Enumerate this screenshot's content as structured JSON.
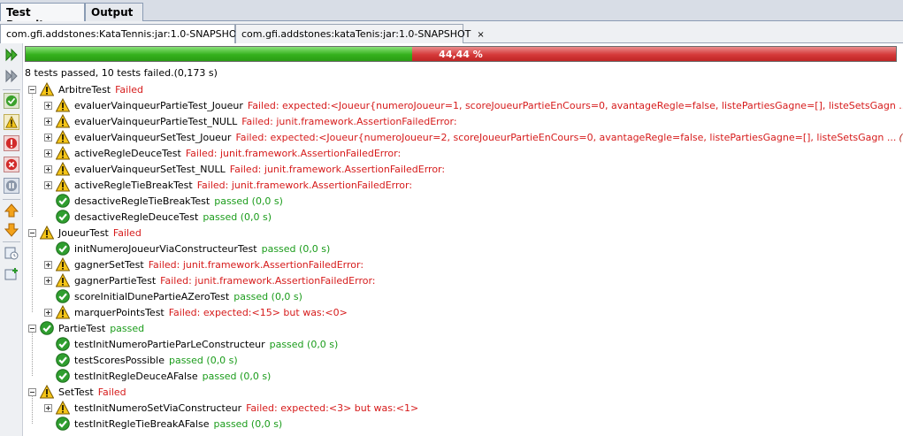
{
  "tabs": [
    {
      "label": "Test Results",
      "close": "×"
    },
    {
      "label": "Output"
    }
  ],
  "project_tabs": [
    {
      "label": "com.gfi.addstones:KataTennis:jar:1.0-SNAPSHOT",
      "close": "×"
    },
    {
      "label": "com.gfi.addstones:kataTenis:jar:1.0-SNAPSHOT",
      "close": "×"
    }
  ],
  "toolbar_icons": [
    "rerun-icon",
    "rerun-failed-icon",
    "show-passed-icon",
    "show-failures-icon",
    "show-errors-icon",
    "show-aborted-icon",
    "show-skipped-icon",
    "previous-failure-icon",
    "next-failure-icon",
    "history-icon",
    "new-test-icon"
  ],
  "progress": {
    "percent_label": "44,44 %",
    "passed_fraction": 0.4444
  },
  "summary": "8 tests passed, 10 tests failed.(0,173 s)",
  "colors": {
    "passed": "#1b9c1b",
    "failed": "#d61b1b",
    "progress_green": "#35b11d",
    "progress_red": "#d53a3a"
  },
  "suites": [
    {
      "name": "ArbitreTest",
      "status": "Failed",
      "result": "failed",
      "tests": [
        {
          "name": "evaluerVainqueurPartieTest_Joueur",
          "message": "Failed: expected:<Joueur{numeroJoueur=1, scoreJoueurPartieEnCours=0, avantageRegle=false, listePartiesGagne=[], listeSetsGagn ...",
          "omitted": "(132 chars omitted)",
          "result": "failed"
        },
        {
          "name": "evaluerVainqueurPartieTest_NULL",
          "message": "Failed: junit.framework.AssertionFailedError:",
          "result": "failed"
        },
        {
          "name": "evaluerVainqueurSetTest_Joueur",
          "message": "Failed: expected:<Joueur{numeroJoueur=2, scoreJoueurPartieEnCours=0, avantageRegle=false, listePartiesGagne=[], listeSetsGagn ...",
          "omitted": "(132 chars omitted)",
          "result": "failed"
        },
        {
          "name": "activeRegleDeuceTest",
          "message": "Failed: junit.framework.AssertionFailedError:",
          "result": "failed"
        },
        {
          "name": "evaluerVainqueurSetTest_NULL",
          "message": "Failed: junit.framework.AssertionFailedError:",
          "result": "failed"
        },
        {
          "name": "activeRegleTieBreakTest",
          "message": "Failed: junit.framework.AssertionFailedError:",
          "result": "failed"
        },
        {
          "name": "desactiveRegleTieBreakTest",
          "message": "passed  (0,0 s)",
          "result": "passed"
        },
        {
          "name": "desactiveRegleDeuceTest",
          "message": "passed  (0,0 s)",
          "result": "passed"
        }
      ]
    },
    {
      "name": "JoueurTest",
      "status": "Failed",
      "result": "failed",
      "tests": [
        {
          "name": "initNumeroJoueurViaConstructeurTest",
          "message": "passed  (0,0 s)",
          "result": "passed"
        },
        {
          "name": "gagnerSetTest",
          "message": "Failed: junit.framework.AssertionFailedError:",
          "result": "failed"
        },
        {
          "name": "gagnerPartieTest",
          "message": "Failed: junit.framework.AssertionFailedError:",
          "result": "failed"
        },
        {
          "name": "scoreInitialDunePartieAZeroTest",
          "message": "passed  (0,0 s)",
          "result": "passed"
        },
        {
          "name": "marquerPointsTest",
          "message": "Failed: expected:<15> but was:<0>",
          "result": "failed"
        }
      ]
    },
    {
      "name": "PartieTest",
      "status": "passed",
      "result": "passed",
      "tests": [
        {
          "name": "testInitNumeroPartieParLeConstructeur",
          "message": "passed  (0,0 s)",
          "result": "passed"
        },
        {
          "name": "testScoresPossible",
          "message": "passed  (0,0 s)",
          "result": "passed"
        },
        {
          "name": "testInitRegleDeuceAFalse",
          "message": "passed  (0,0 s)",
          "result": "passed"
        }
      ]
    },
    {
      "name": "SetTest",
      "status": "Failed",
      "result": "failed",
      "tests": [
        {
          "name": "testInitNumeroSetViaConstructeur",
          "message": "Failed: expected:<3> but was:<1>",
          "result": "failed"
        },
        {
          "name": "testInitRegleTieBreakAFalse",
          "message": "passed  (0,0 s)",
          "result": "passed"
        }
      ]
    }
  ]
}
